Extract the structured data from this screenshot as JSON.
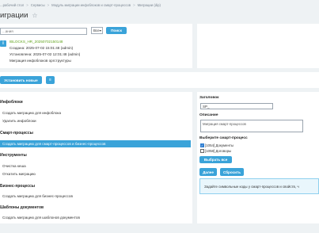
{
  "breadcrumbs": [
    "...рабочий стол",
    "Сервисы",
    "Модуль миграции инфоблоков и смарт-процессов",
    "Миграции (dip)"
  ],
  "page": {
    "title": "играции",
    "star": "☆"
  },
  "search": {
    "placeholder": "...ания",
    "select_value": "Все",
    "search_button": "Поиск"
  },
  "migration": {
    "name": "IBLOCKS_HR_20250702150148",
    "created": "Создана: 2025-07-02 15:01:48 (admin)",
    "installed": "Установлена: 2025-07-02 12:01:48 (admin)",
    "description": "Миграция инфоблоков оргструктуры"
  },
  "toolbar": {
    "install_new": "Установить новые",
    "more": "≡"
  },
  "menu": {
    "sections": [
      {
        "title": "Инфоблоки",
        "items": [
          "Создать миграцию для инфоблока",
          "Удалить инфоблоки"
        ]
      },
      {
        "title": "Смарт-процессы",
        "items": [
          "Создать миграцию для смарт-процессов и бизнес-процессов"
        ]
      },
      {
        "title": "Инструменты",
        "items": [
          "Очистка кеша",
          "Откатить миграцию"
        ]
      },
      {
        "title": "Бизнес-процессы",
        "items": [
          "Создать миграцию для бизнес-процессов"
        ]
      },
      {
        "title": "Шаблоны документов",
        "items": [
          "Создать миграцию для шаблонов документов"
        ]
      }
    ]
  },
  "form": {
    "header_label": "Заголовок",
    "header_value": "SP_",
    "description_label": "Описание",
    "description_value": "Миграция смарт-процессов",
    "choose_label": "Выберите смарт-процесс",
    "options": [
      {
        "label": "[1054] Документы",
        "checked": true
      },
      {
        "label": "[1058] Договоры",
        "checked": false
      }
    ],
    "select_all": "Выбрать все",
    "next": "Далее",
    "reset": "Сбросить",
    "notice": "Задайте символьные коды у смарт-процессов и свойств, ч"
  },
  "colors": {
    "accent": "#3aa3d9",
    "success": "#5fa21c",
    "background": "#eef2f4"
  }
}
